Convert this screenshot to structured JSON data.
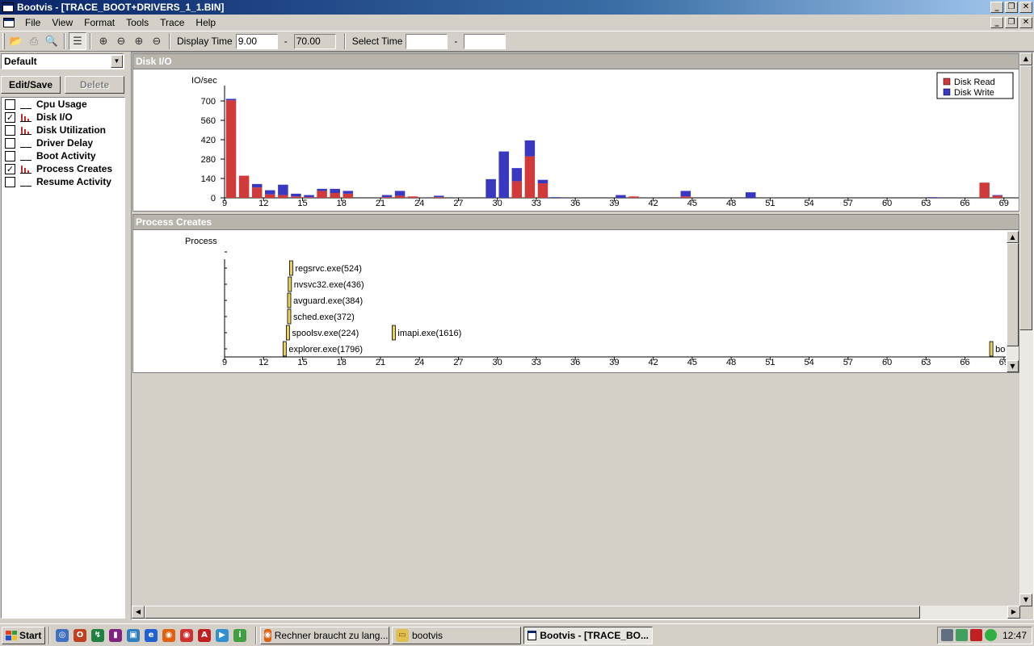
{
  "window": {
    "title": "Bootvis - [TRACE_BOOT+DRIVERS_1_1.BIN]"
  },
  "menu": [
    "File",
    "View",
    "Format",
    "Tools",
    "Trace",
    "Help"
  ],
  "toolbar": {
    "display_time_label": "Display Time",
    "display_time_from": "9.00",
    "display_time_to": "70.00",
    "dash": "-",
    "select_time_label": "Select Time",
    "select_time_from": "",
    "select_time_to": ""
  },
  "left_panel": {
    "profile": "Default",
    "edit_save": "Edit/Save",
    "delete": "Delete",
    "graphs": [
      {
        "label": "Cpu Usage",
        "checked": false,
        "icon": false
      },
      {
        "label": "Disk I/O",
        "checked": true,
        "icon": true
      },
      {
        "label": "Disk Utilization",
        "checked": false,
        "icon": true
      },
      {
        "label": "Driver Delay",
        "checked": false,
        "icon": false
      },
      {
        "label": "Boot Activity",
        "checked": false,
        "icon": false
      },
      {
        "label": "Process Creates",
        "checked": true,
        "icon": true
      },
      {
        "label": "Resume Activity",
        "checked": false,
        "icon": false
      }
    ]
  },
  "disk_io": {
    "title": "Disk I/O",
    "ylabel": "IO/sec",
    "legend": [
      "Disk Read",
      "Disk Write"
    ],
    "colors": {
      "read": "#d03a3a",
      "write": "#3838c0"
    }
  },
  "process_creates": {
    "title": "Process Creates",
    "ylabel": "Process",
    "processes": [
      {
        "name": "regsrvc.exe(524)",
        "t": 14.0,
        "row": 5
      },
      {
        "name": "nvsvc32.exe(436)",
        "t": 13.9,
        "row": 4
      },
      {
        "name": "avguard.exe(384)",
        "t": 13.85,
        "row": 3
      },
      {
        "name": "sched.exe(372)",
        "t": 13.85,
        "row": 2
      },
      {
        "name": "spoolsv.exe(224)",
        "t": 13.75,
        "row": 1
      },
      {
        "name": "imapi.exe(1616)",
        "t": 21.9,
        "row": 1
      },
      {
        "name": "explorer.exe(1796)",
        "t": 13.5,
        "row": 0
      },
      {
        "name": "boot",
        "t": 67.9,
        "row": 0
      }
    ]
  },
  "chart_data": {
    "type": "bar",
    "title": "Disk I/O",
    "ylabel": "IO/sec",
    "xlim": [
      9,
      70
    ],
    "ylim": [
      0,
      760
    ],
    "x_ticks": [
      "9",
      "12",
      "15",
      "18",
      "21",
      "24",
      "27",
      "30",
      "33",
      "36",
      "39",
      "42",
      "45",
      "48",
      "51",
      "54",
      "57",
      "60",
      "63",
      "66",
      "69"
    ],
    "y_ticks": [
      "0",
      "140",
      "280",
      "420",
      "560",
      "700"
    ],
    "legend_position": "top-right",
    "categories": [
      9,
      10,
      11,
      12,
      13,
      14,
      15,
      16,
      17,
      18,
      19,
      20,
      21,
      22,
      23,
      24,
      25,
      26,
      27,
      28,
      29,
      30,
      31,
      32,
      33,
      34,
      35,
      36,
      37,
      38,
      39,
      40,
      41,
      42,
      43,
      44,
      45,
      46,
      47,
      48,
      49,
      50,
      51,
      52,
      53,
      54,
      55,
      56,
      57,
      58,
      59,
      60,
      61,
      62,
      63,
      64,
      65,
      66,
      67,
      68
    ],
    "series": [
      {
        "name": "Disk Read",
        "values": [
          705,
          160,
          75,
          25,
          20,
          10,
          5,
          50,
          35,
          30,
          0,
          0,
          5,
          15,
          10,
          0,
          5,
          0,
          0,
          0,
          0,
          0,
          120,
          300,
          105,
          0,
          0,
          0,
          0,
          0,
          0,
          10,
          0,
          0,
          0,
          10,
          0,
          0,
          0,
          0,
          0,
          0,
          0,
          0,
          0,
          0,
          0,
          0,
          0,
          0,
          0,
          0,
          0,
          0,
          0,
          0,
          0,
          0,
          110,
          15
        ]
      },
      {
        "name": "Disk Write",
        "values": [
          10,
          0,
          25,
          30,
          75,
          20,
          15,
          15,
          30,
          20,
          0,
          0,
          15,
          35,
          0,
          0,
          10,
          0,
          0,
          0,
          135,
          335,
          95,
          115,
          25,
          5,
          0,
          0,
          0,
          0,
          20,
          0,
          0,
          0,
          0,
          40,
          0,
          0,
          0,
          0,
          40,
          0,
          0,
          0,
          0,
          0,
          0,
          0,
          0,
          0,
          0,
          0,
          0,
          0,
          5,
          0,
          0,
          0,
          0,
          5
        ]
      }
    ]
  },
  "taskbar": {
    "start": "Start",
    "tasks": [
      {
        "label": "Rechner braucht zu lang...",
        "active": false
      },
      {
        "label": "bootvis",
        "active": false
      },
      {
        "label": "Bootvis - [TRACE_BO...",
        "active": true
      }
    ],
    "clock": "12:47"
  }
}
